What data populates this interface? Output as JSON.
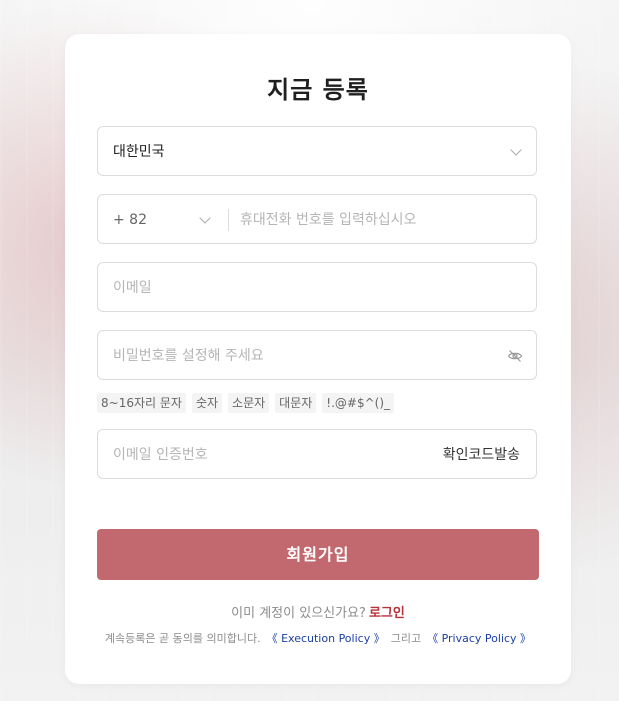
{
  "page": {
    "title": "지금 등록"
  },
  "form": {
    "country": {
      "value": "대한민국"
    },
    "phone": {
      "country_code": "+ 82",
      "placeholder": "휴대전화 번호를 입력하십시오"
    },
    "email": {
      "placeholder": "이메일"
    },
    "password": {
      "placeholder": "비밀번호를 설정해 주세요",
      "toggle_icon": "eye-off-icon"
    },
    "password_rules": [
      "8~16자리 문자",
      "숫자",
      "소문자",
      "대문자",
      "!.@#$^()_"
    ],
    "email_code": {
      "placeholder": "이메일 인증번호",
      "send_label": "확인코드발송"
    },
    "submit_label": "회원가입"
  },
  "footer": {
    "have_account": "이미 계정이 있으신가요?",
    "login_label": "로그인",
    "agree_text": "계속등록은 곧 동의를 의미합니다.",
    "execution_policy": "《 Execution Policy 》",
    "and_text": "그리고",
    "privacy_policy": "《 Privacy Policy 》"
  },
  "colors": {
    "primary": "#c1696e",
    "link_red": "#b8323a",
    "link_blue": "#1b3fa6"
  }
}
